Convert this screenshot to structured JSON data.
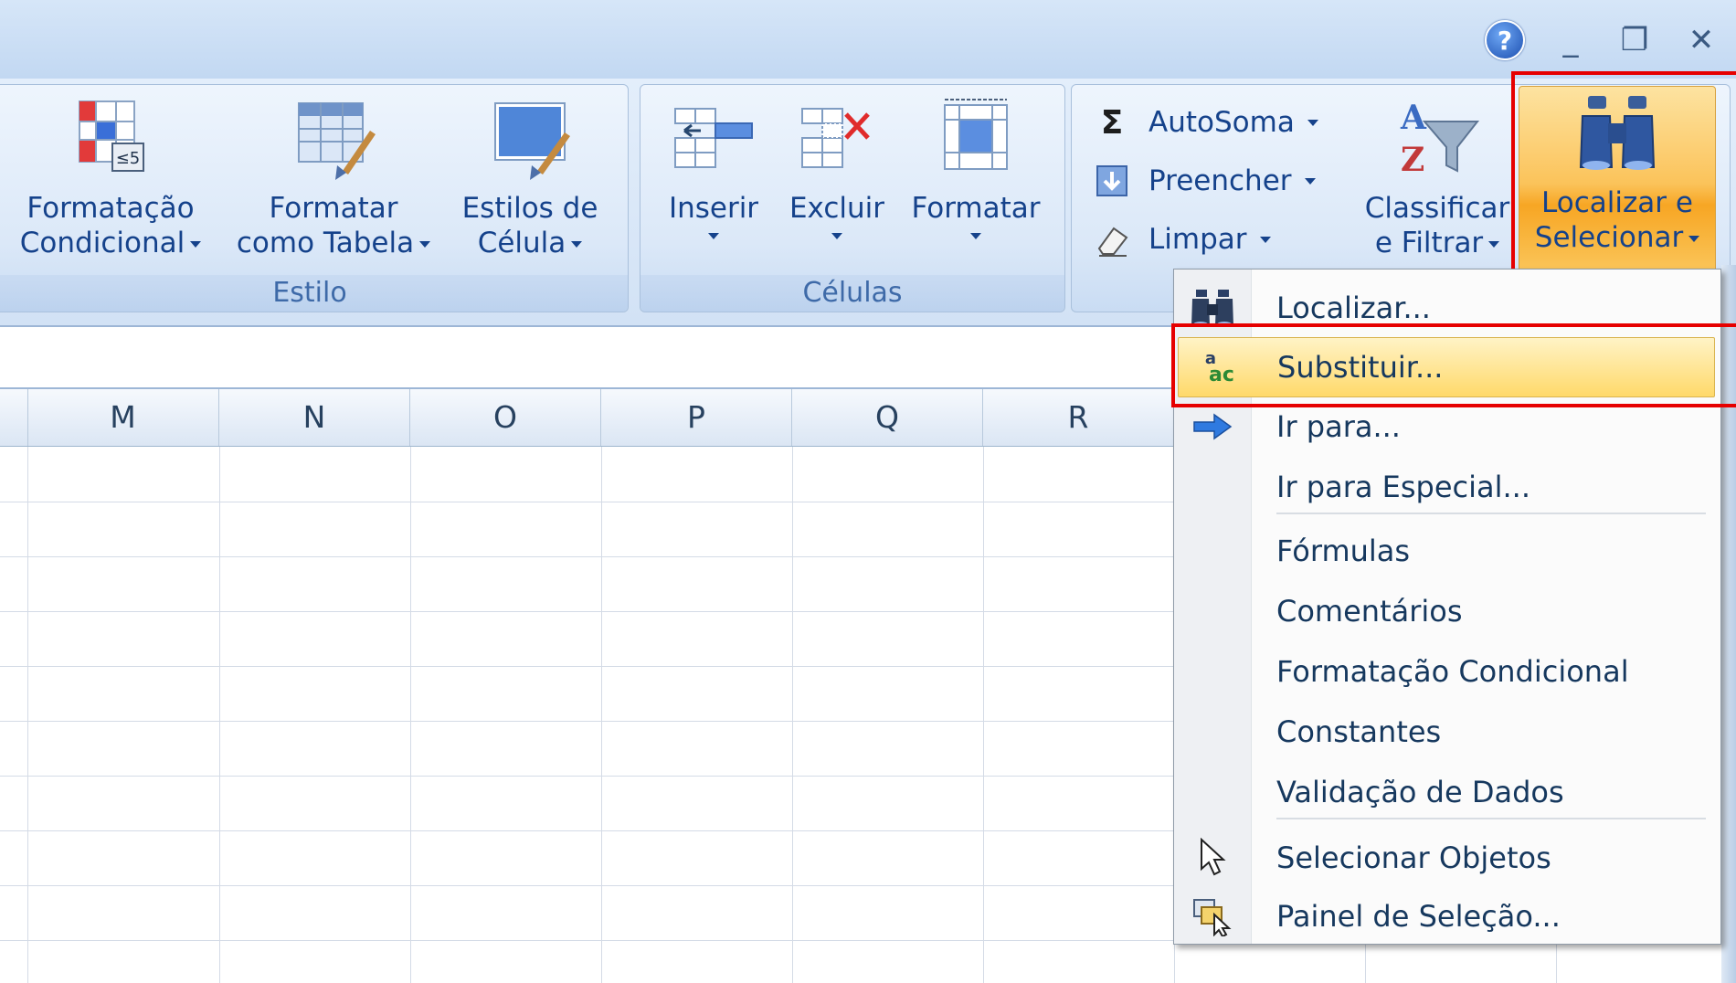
{
  "window": {
    "help_label": "?",
    "minimize_label": "_",
    "maximize_label": "❐",
    "close_label": "✕"
  },
  "ribbon": {
    "estilo": {
      "label": "Estilo",
      "buttons": [
        {
          "line1": "Formatação",
          "line2": "Condicional"
        },
        {
          "line1": "Formatar",
          "line2": "como Tabela"
        },
        {
          "line1": "Estilos de",
          "line2": "Célula"
        }
      ]
    },
    "celulas": {
      "label": "Células",
      "buttons": [
        {
          "line1": "Inserir"
        },
        {
          "line1": "Excluir"
        },
        {
          "line1": "Formatar"
        }
      ]
    },
    "edicao": {
      "autosoma": "AutoSoma",
      "preencher": "Preencher",
      "limpar": "Limpar",
      "classificar_line1": "Classificar",
      "classificar_line2": "e Filtrar",
      "localizar_line1": "Localizar e",
      "localizar_line2": "Selecionar"
    }
  },
  "columns": [
    "M",
    "N",
    "O",
    "P",
    "Q",
    "R"
  ],
  "menu": {
    "items": [
      {
        "label": "Localizar...",
        "icon": "binoculars-icon"
      },
      {
        "label": "Substituir...",
        "icon": "replace-icon",
        "highlighted": true
      },
      {
        "label": "Ir para...",
        "icon": "arrow-right-icon"
      },
      {
        "label": "Ir para Especial...",
        "icon": ""
      },
      {
        "label": "Fórmulas",
        "icon": ""
      },
      {
        "label": "Comentários",
        "icon": ""
      },
      {
        "label": "Formatação Condicional",
        "icon": ""
      },
      {
        "label": "Constantes",
        "icon": ""
      },
      {
        "label": "Validação de Dados",
        "icon": ""
      },
      {
        "label": "Selecionar Objetos",
        "icon": "cursor-icon"
      },
      {
        "label": "Painel de Seleção...",
        "icon": "selection-pane-icon"
      }
    ]
  },
  "colors": {
    "highlight_border": "#e60000",
    "ribbon_text": "#15428b",
    "accent_orange": "#f7a624"
  }
}
